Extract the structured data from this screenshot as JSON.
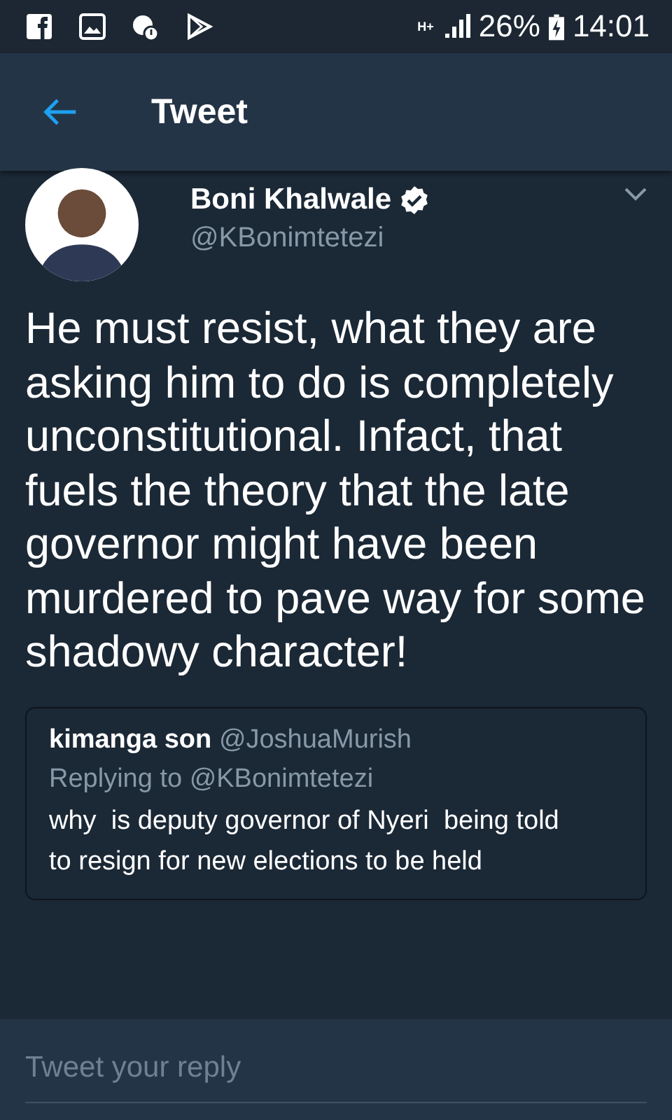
{
  "status_bar": {
    "signal_type": "H+",
    "battery": "26%",
    "time": "14:01"
  },
  "header": {
    "title": "Tweet"
  },
  "tweet": {
    "name": "Boni Khalwale",
    "verified": true,
    "handle": "@KBonimtetezi",
    "text": "He must resist, what they are asking him to do is completely unconstitutional. Infact, that fuels the theory that the late governor might have been murdered to pave way for some shadowy character!",
    "quote": {
      "name": "kimanga son",
      "handle": "@JoshuaMurish",
      "replying_to": "Replying to @KBonimtetezi",
      "text": "why  is deputy governor of Nyeri  being told to resign for new elections to be held"
    }
  },
  "reply_bar": {
    "placeholder": "Tweet your reply"
  }
}
